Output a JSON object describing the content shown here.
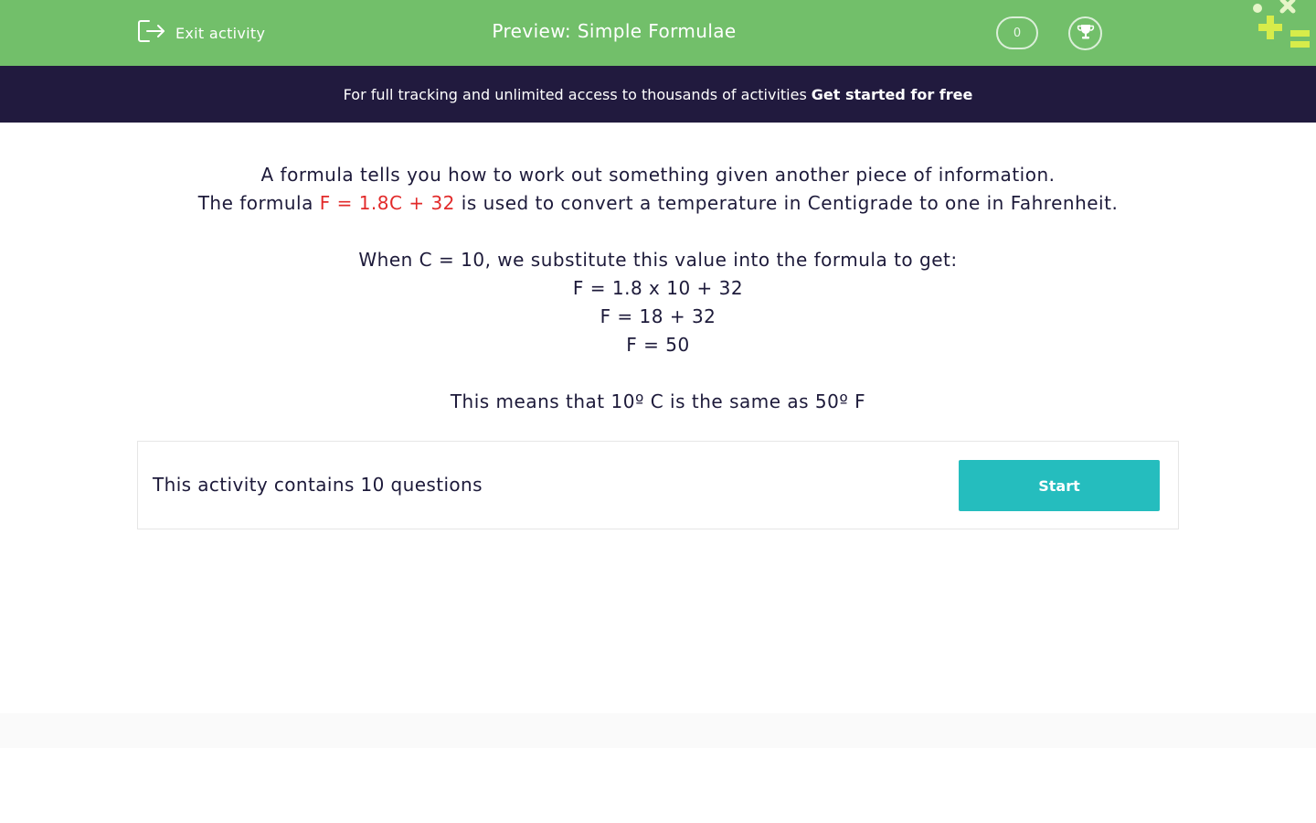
{
  "header": {
    "exit_label": "Exit activity",
    "title": "Preview: Simple Formulae",
    "score": "0",
    "icons": {
      "exit": "exit-icon",
      "trophy": "trophy-icon",
      "logo": "brand-logo"
    },
    "background_color": "#72bf6a"
  },
  "banner": {
    "text": "For full tracking and unlimited access to thousands of activities",
    "cta": "Get started for free",
    "background_color": "#211a3e"
  },
  "intro": {
    "line1": "A formula tells you how to work out something given another piece of information.",
    "line2_before": "The formula",
    "line2_formula": "F = 1.8C + 32",
    "line2_after": "is used to convert a temperature in Centigrade to one in Fahrenheit.",
    "formula_color": "#e22a2a",
    "example_heading": "When C = 10, we substitute this value into the formula to get:",
    "steps": [
      "F = 1.8 x 10 + 32",
      "F = 18 + 32",
      "F = 50"
    ],
    "conclusion": "This means that 10º C is the same as 50º F"
  },
  "activity": {
    "summary": "This activity contains 10 questions",
    "start_label": "Start",
    "button_color": "#25bdbe"
  }
}
